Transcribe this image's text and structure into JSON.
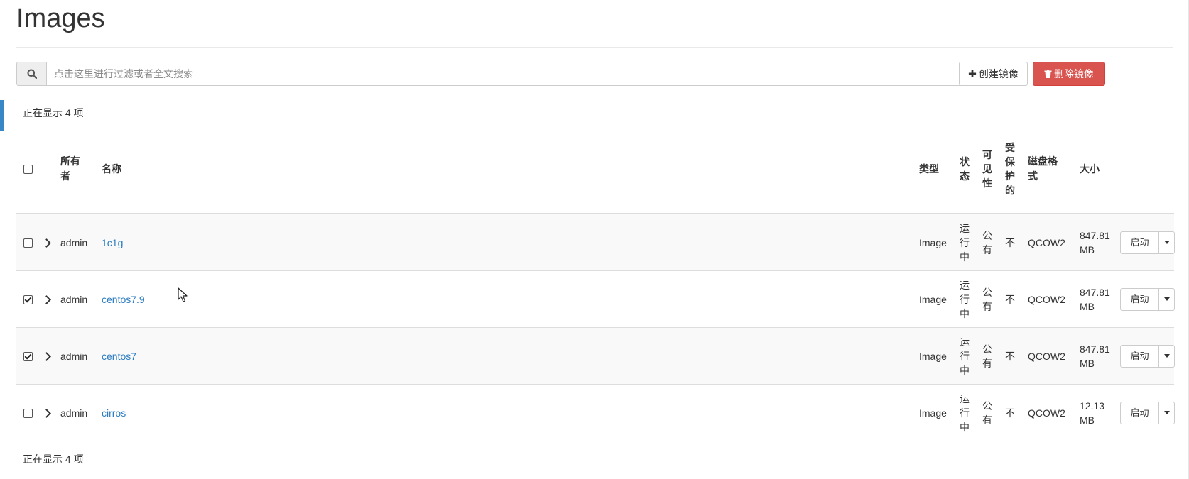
{
  "page": {
    "title": "Images"
  },
  "search": {
    "placeholder": "点击这里进行过滤或者全文搜索",
    "value": ""
  },
  "toolbar": {
    "create_label": "创建镜像",
    "delete_label": "删除镜像"
  },
  "summary": {
    "top": "正在显示 4 项",
    "bottom": "正在显示 4 项"
  },
  "table": {
    "columns": {
      "owner": "所有者",
      "name": "名称",
      "type": "类型",
      "status": "状态",
      "visibility": "可见性",
      "protected": "受保护的",
      "disk_format": "磁盘格式",
      "size": "大小"
    },
    "rows": [
      {
        "checked": false,
        "owner": "admin",
        "name": "1c1g",
        "type": "Image",
        "status": "运行中",
        "visibility": "公有",
        "protected": "不",
        "disk_format": "QCOW2",
        "size": "847.81 MB",
        "action": "启动"
      },
      {
        "checked": true,
        "owner": "admin",
        "name": "centos7.9",
        "type": "Image",
        "status": "运行中",
        "visibility": "公有",
        "protected": "不",
        "disk_format": "QCOW2",
        "size": "847.81 MB",
        "action": "启动"
      },
      {
        "checked": true,
        "owner": "admin",
        "name": "centos7",
        "type": "Image",
        "status": "运行中",
        "visibility": "公有",
        "protected": "不",
        "disk_format": "QCOW2",
        "size": "847.81 MB",
        "action": "启动"
      },
      {
        "checked": false,
        "owner": "admin",
        "name": "cirros",
        "type": "Image",
        "status": "运行中",
        "visibility": "公有",
        "protected": "不",
        "disk_format": "QCOW2",
        "size": "12.13 MB",
        "action": "启动"
      }
    ]
  },
  "colors": {
    "accent": "#3a87c8",
    "link": "#2a7bc1",
    "danger": "#d9534f"
  },
  "icons": {
    "search": "search-icon",
    "clear": "clear-icon",
    "plus": "plus-icon",
    "trash": "trash-icon",
    "chevron": "chevron-right-icon",
    "caret": "caret-down-icon"
  }
}
